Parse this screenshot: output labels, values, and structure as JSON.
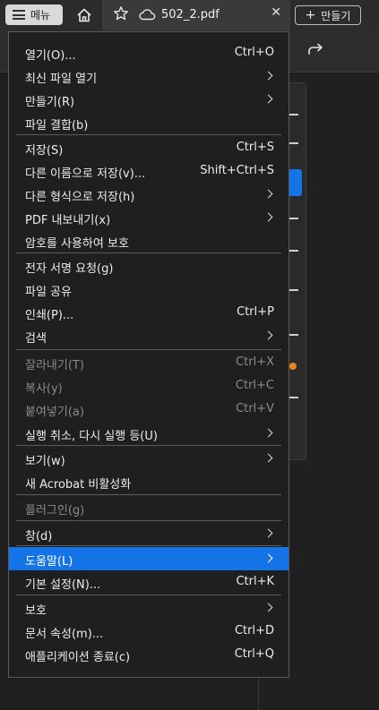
{
  "topbar": {
    "menu_label": "메뉴",
    "tab_title": "502_2.pdf",
    "create_label": "만들기"
  },
  "menu": {
    "items": [
      {
        "label": "열기(O)...",
        "shortcut": "Ctrl+O"
      },
      {
        "label": "최신 파일 열기",
        "submenu": true
      },
      {
        "label": "만들기(R)",
        "submenu": true
      },
      {
        "label": "파일 결합(b)"
      },
      {
        "label": "저장(S)",
        "shortcut": "Ctrl+S"
      },
      {
        "label": "다른 이름으로 저장(v)...",
        "shortcut": "Shift+Ctrl+S"
      },
      {
        "label": "다른 형식으로 저장(h)",
        "submenu": true
      },
      {
        "label": "PDF 내보내기(x)",
        "submenu": true
      },
      {
        "label": "암호를 사용하여 보호"
      },
      {
        "label": "전자 서명 요청(g)"
      },
      {
        "label": "파일 공유"
      },
      {
        "label": "인쇄(P)...",
        "shortcut": "Ctrl+P"
      },
      {
        "label": "검색",
        "submenu": true
      },
      {
        "label": "잘라내기(T)",
        "shortcut": "Ctrl+X",
        "disabled": true
      },
      {
        "label": "복사(y)",
        "shortcut": "Ctrl+C",
        "disabled": true
      },
      {
        "label": "붙여넣기(a)",
        "shortcut": "Ctrl+V",
        "disabled": true
      },
      {
        "label": "실행 취소, 다시 실행 등(U)",
        "submenu": true
      },
      {
        "label": "보기(w)",
        "submenu": true
      },
      {
        "label": "새 Acrobat 비활성화"
      },
      {
        "label": "플러그인(g)",
        "disabled": true
      },
      {
        "label": "창(d)",
        "submenu": true
      },
      {
        "label": "도움말(L)",
        "submenu": true,
        "highlighted": true
      },
      {
        "label": "기본 설정(N)...",
        "shortcut": "Ctrl+K"
      },
      {
        "label": "보호",
        "submenu": true
      },
      {
        "label": "문서 속성(m)...",
        "shortcut": "Ctrl+D"
      },
      {
        "label": "애플리케이션 종료(c)",
        "shortcut": "Ctrl+Q"
      }
    ]
  },
  "colors": {
    "highlight": "#1473e6",
    "menu_bg": "#1f1f1f",
    "disabled_text": "#8a8a8a"
  }
}
